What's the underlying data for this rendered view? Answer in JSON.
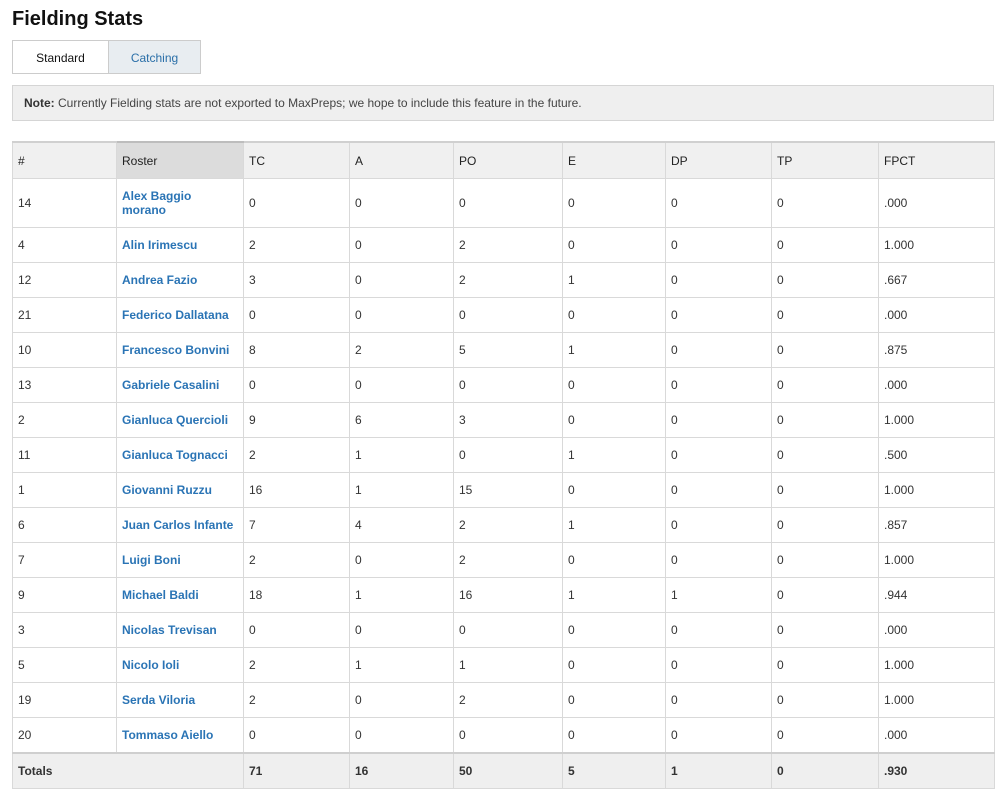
{
  "page": {
    "title": "Fielding Stats"
  },
  "tabs": [
    {
      "label": "Standard",
      "active": true
    },
    {
      "label": "Catching",
      "active": false
    }
  ],
  "note": {
    "label": "Note:",
    "text": "Currently Fielding stats are not exported to MaxPreps; we hope to include this feature in the future."
  },
  "colors": {
    "link": "#2a74b5",
    "tab_inactive_bg": "#e8edf1",
    "header_bg": "#f0f0f0",
    "sorted_header_bg": "#dcdcdc"
  },
  "table": {
    "columns": [
      "#",
      "Roster",
      "TC",
      "A",
      "PO",
      "E",
      "DP",
      "TP",
      "FPCT"
    ],
    "sorted_column": "Roster",
    "rows": [
      {
        "num": "14",
        "name": "Alex Baggio morano",
        "tc": "0",
        "a": "0",
        "po": "0",
        "e": "0",
        "dp": "0",
        "tp": "0",
        "fpct": ".000"
      },
      {
        "num": "4",
        "name": "Alin Irimescu",
        "tc": "2",
        "a": "0",
        "po": "2",
        "e": "0",
        "dp": "0",
        "tp": "0",
        "fpct": "1.000"
      },
      {
        "num": "12",
        "name": "Andrea Fazio",
        "tc": "3",
        "a": "0",
        "po": "2",
        "e": "1",
        "dp": "0",
        "tp": "0",
        "fpct": ".667"
      },
      {
        "num": "21",
        "name": "Federico Dallatana",
        "tc": "0",
        "a": "0",
        "po": "0",
        "e": "0",
        "dp": "0",
        "tp": "0",
        "fpct": ".000"
      },
      {
        "num": "10",
        "name": "Francesco Bonvini",
        "tc": "8",
        "a": "2",
        "po": "5",
        "e": "1",
        "dp": "0",
        "tp": "0",
        "fpct": ".875"
      },
      {
        "num": "13",
        "name": "Gabriele Casalini",
        "tc": "0",
        "a": "0",
        "po": "0",
        "e": "0",
        "dp": "0",
        "tp": "0",
        "fpct": ".000"
      },
      {
        "num": "2",
        "name": "Gianluca Quercioli",
        "tc": "9",
        "a": "6",
        "po": "3",
        "e": "0",
        "dp": "0",
        "tp": "0",
        "fpct": "1.000"
      },
      {
        "num": "11",
        "name": "Gianluca Tognacci",
        "tc": "2",
        "a": "1",
        "po": "0",
        "e": "1",
        "dp": "0",
        "tp": "0",
        "fpct": ".500"
      },
      {
        "num": "1",
        "name": "Giovanni Ruzzu",
        "tc": "16",
        "a": "1",
        "po": "15",
        "e": "0",
        "dp": "0",
        "tp": "0",
        "fpct": "1.000"
      },
      {
        "num": "6",
        "name": "Juan Carlos Infante",
        "tc": "7",
        "a": "4",
        "po": "2",
        "e": "1",
        "dp": "0",
        "tp": "0",
        "fpct": ".857"
      },
      {
        "num": "7",
        "name": "Luigi Boni",
        "tc": "2",
        "a": "0",
        "po": "2",
        "e": "0",
        "dp": "0",
        "tp": "0",
        "fpct": "1.000"
      },
      {
        "num": "9",
        "name": "Michael Baldi",
        "tc": "18",
        "a": "1",
        "po": "16",
        "e": "1",
        "dp": "1",
        "tp": "0",
        "fpct": ".944"
      },
      {
        "num": "3",
        "name": "Nicolas Trevisan",
        "tc": "0",
        "a": "0",
        "po": "0",
        "e": "0",
        "dp": "0",
        "tp": "0",
        "fpct": ".000"
      },
      {
        "num": "5",
        "name": "Nicolo Ioli",
        "tc": "2",
        "a": "1",
        "po": "1",
        "e": "0",
        "dp": "0",
        "tp": "0",
        "fpct": "1.000"
      },
      {
        "num": "19",
        "name": "Serda Viloria",
        "tc": "2",
        "a": "0",
        "po": "2",
        "e": "0",
        "dp": "0",
        "tp": "0",
        "fpct": "1.000"
      },
      {
        "num": "20",
        "name": "Tommaso Aiello",
        "tc": "0",
        "a": "0",
        "po": "0",
        "e": "0",
        "dp": "0",
        "tp": "0",
        "fpct": ".000"
      }
    ],
    "totals": {
      "label": "Totals",
      "tc": "71",
      "a": "16",
      "po": "50",
      "e": "5",
      "dp": "1",
      "tp": "0",
      "fpct": ".930"
    }
  }
}
